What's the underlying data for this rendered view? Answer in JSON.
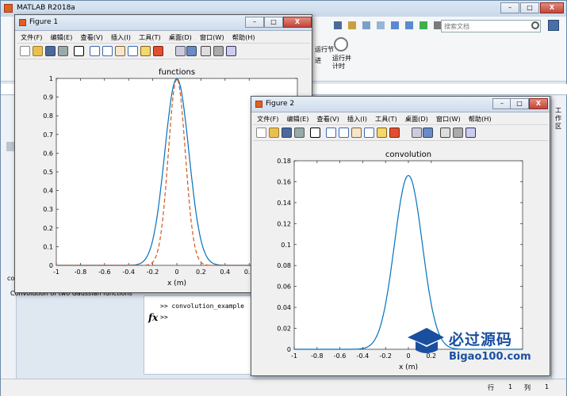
{
  "app": {
    "title": "MATLAB R2018a",
    "search_placeholder": "搜索文档",
    "ribbon_run_section": "运行节",
    "ribbon_run_advance": "运行并\n计时",
    "ribbon_advance": "进",
    "right_panel_label": "工作区",
    "command_history": [
      ">> convolution_example",
      ">>"
    ],
    "command_prompt_symbol": "fx",
    "left_fragment": "co",
    "left_truncated_text": "Convolution of two Gaussian functions",
    "status": {
      "row_label": "行",
      "row": "1",
      "col_label": "列",
      "col": "1"
    }
  },
  "figure1": {
    "title": "Figure 1",
    "menu": [
      "文件(F)",
      "编辑(E)",
      "查看(V)",
      "插入(I)",
      "工具(T)",
      "桌面(D)",
      "窗口(W)",
      "帮助(H)"
    ],
    "window_buttons": {
      "minimize": "–",
      "maximize": "□",
      "close": "X"
    }
  },
  "figure2": {
    "title": "Figure 2",
    "menu": [
      "文件(F)",
      "编辑(E)",
      "查看(V)",
      "插入(I)",
      "工具(T)",
      "桌面(D)",
      "窗口(W)",
      "帮助(H)"
    ],
    "window_buttons": {
      "minimize": "–",
      "maximize": "□",
      "close": "X"
    }
  },
  "watermark": {
    "text": "必过源码",
    "url": "Bigao100.com"
  },
  "chart_data": [
    {
      "type": "line",
      "title": "functions",
      "xlabel": "x (m)",
      "ylabel": "",
      "xlim": [
        -1,
        1
      ],
      "ylim": [
        0,
        1
      ],
      "xticks": [
        "-1",
        "-0.8",
        "-0.6",
        "-0.4",
        "-0.2",
        "0",
        "0.2",
        "0.4",
        "0.6"
      ],
      "yticks": [
        "0",
        "0.1",
        "0.2",
        "0.3",
        "0.4",
        "0.5",
        "0.6",
        "0.7",
        "0.8",
        "0.9",
        "1"
      ],
      "series": [
        {
          "style": "solid",
          "color": "#0072bd",
          "sigma": 0.1,
          "peak": 1.0
        },
        {
          "style": "dashed",
          "color": "#d95319",
          "sigma": 0.07,
          "peak": 1.0
        }
      ]
    },
    {
      "type": "line",
      "title": "convolution",
      "xlabel": "x (m)",
      "ylabel": "",
      "xlim": [
        -1,
        1
      ],
      "ylim": [
        0,
        0.18
      ],
      "xticks": [
        "-1",
        "-0.8",
        "-0.6",
        "-0.4",
        "-0.2",
        "0",
        "0.2"
      ],
      "yticks": [
        "0",
        "0.02",
        "0.04",
        "0.06",
        "0.08",
        "0.1",
        "0.12",
        "0.14",
        "0.16",
        "0.18"
      ],
      "series": [
        {
          "style": "solid",
          "color": "#0072bd",
          "sigma": 0.122,
          "peak": 0.166
        }
      ]
    }
  ]
}
